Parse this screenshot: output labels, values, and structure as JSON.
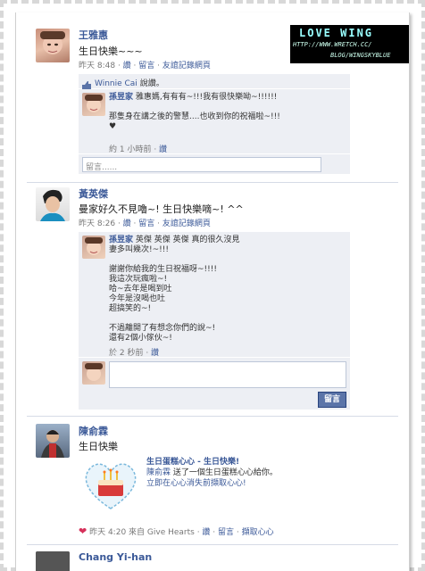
{
  "watermark": {
    "title": "LOVE WING",
    "url": "HTTP://WWW.WRETCH.CC/",
    "path": "BLOG/WINGSKYBLUE"
  },
  "posts": [
    {
      "author": "王雅惠",
      "text": "生日快樂~~~",
      "time": "昨天 8:48",
      "actions": [
        "讚",
        "留言",
        "友誼記錄網頁"
      ],
      "likes_prefix": "Winnie Cai",
      "likes_suffix": "說讚。",
      "comment": {
        "author": "孫昱家",
        "lines": [
          "雅惠媽,有有有~!!!我有很快樂呦~!!!!!!",
          "",
          "那隻身在講之後的警慧....也收到你的祝福啦~!!!",
          "♥"
        ],
        "time": "約 1 小時前",
        "action": "讚"
      },
      "input_placeholder": "留言......"
    },
    {
      "author": "黃英傑",
      "text": "曼家好久不見嚕~! 生日快樂嘀~! ^^",
      "time": "昨天 8:26",
      "actions": [
        "讚",
        "留言",
        "友誼記錄網頁"
      ],
      "comment": {
        "author": "孫昱家",
        "first_line": "英傑 英傑 英傑 真的很久沒見",
        "lines": [
          "妻多叫幾次!~!!!",
          "",
          "謝謝你給我的生日祝福呀~!!!!",
          "我這次玩瘋啦~!",
          "哈~去年是喝到吐",
          "今年是沒喝也吐",
          "超搞笑的~!",
          "",
          "不過離開了有想念你們的說~!",
          "還有2個小傢伙~!"
        ],
        "time": "於 2 秒前",
        "action": "讚"
      },
      "button": "留言"
    },
    {
      "author": "陳俞霖",
      "text": "生日快樂",
      "gift_title": "生日蛋糕心心 - 生日快樂!",
      "gift_line1_name": "陳俞霖",
      "gift_line1_rest": " 送了一個生日蛋糕心心給你。",
      "gift_line2": "立即在心心消失前擷取心心!",
      "time": "昨天 4:20 來自 Give Hearts",
      "actions": [
        "讚",
        "留言",
        "擷取心心"
      ]
    },
    {
      "author": "Chang Yi-han"
    }
  ]
}
